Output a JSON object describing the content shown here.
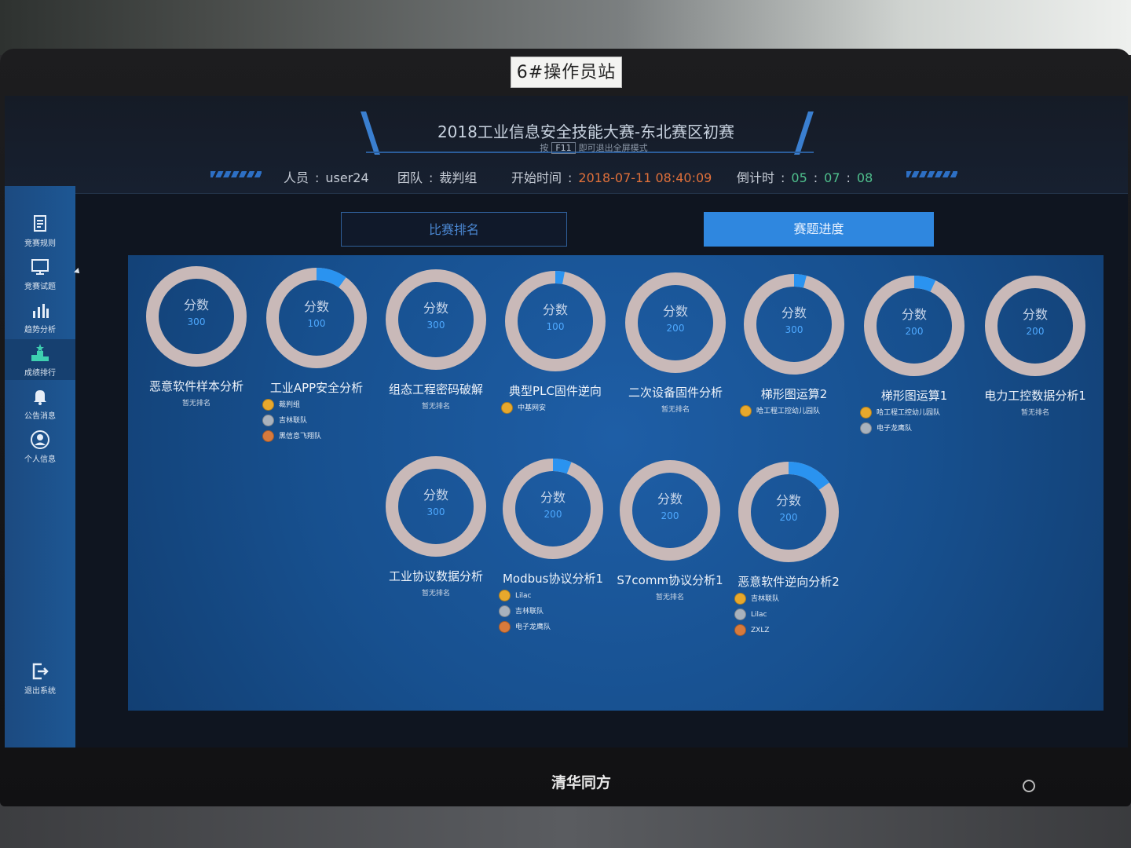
{
  "station_label": "6#操作员站",
  "monitor_brand": "清华同方",
  "header": {
    "title": "2018工业信息安全技能大赛-东北赛区初赛",
    "f11_prefix": "按",
    "f11_key": "F11",
    "f11_suffix": "即可退出全屏模式",
    "user_label": "人员",
    "user_value": "user24",
    "team_label": "团队",
    "team_value": "裁判组",
    "start_label": "开始时间",
    "start_value": "2018-07-11 08:40:09",
    "countdown_label": "倒计时",
    "countdown": [
      "05",
      "07",
      "08"
    ]
  },
  "sidebar": {
    "items": [
      {
        "label": "竞赛规则",
        "icon": "rules-icon"
      },
      {
        "label": "竞赛试题",
        "icon": "monitor-icon"
      },
      {
        "label": "趋势分析",
        "icon": "bar-chart-icon"
      },
      {
        "label": "成绩排行",
        "icon": "podium-icon"
      },
      {
        "label": "公告消息",
        "icon": "bell-icon"
      },
      {
        "label": "个人信息",
        "icon": "user-icon"
      }
    ],
    "logout": {
      "label": "退出系统",
      "icon": "logout-icon"
    }
  },
  "tabs": {
    "ranking": "比赛排名",
    "progress": "赛题进度"
  },
  "ring_caption": "分数",
  "no_rank_text": "暂无排名",
  "colors": {
    "ring_base": "#c9b9b8",
    "ring_progress": "#2a93f0",
    "accent": "#2f87df",
    "time": "#e0703a",
    "countdown": "#4fc08d"
  },
  "challenges": [
    {
      "name": "恶意软件样本分析",
      "score": "300",
      "progress": 0,
      "ranks": []
    },
    {
      "name": "工业APP安全分析",
      "score": "100",
      "progress": 0.1,
      "ranks": [
        {
          "medal": "gold",
          "team": "裁判组"
        },
        {
          "medal": "silver",
          "team": "吉林联队"
        },
        {
          "medal": "bronze",
          "team": "黑信息飞翔队"
        }
      ]
    },
    {
      "name": "组态工程密码破解",
      "score": "300",
      "progress": 0,
      "ranks": []
    },
    {
      "name": "典型PLC固件逆向",
      "score": "100",
      "progress": 0.03,
      "ranks": [
        {
          "medal": "gold",
          "team": "中基网安"
        }
      ]
    },
    {
      "name": "二次设备固件分析",
      "score": "200",
      "progress": 0,
      "ranks": []
    },
    {
      "name": "梯形图运算2",
      "score": "300",
      "progress": 0.04,
      "ranks": [
        {
          "medal": "gold",
          "team": "哈工程工控幼儿园队"
        }
      ]
    },
    {
      "name": "梯形图运算1",
      "score": "200",
      "progress": 0.07,
      "ranks": [
        {
          "medal": "gold",
          "team": "哈工程工控幼儿园队"
        },
        {
          "medal": "silver",
          "team": "电子龙鹰队"
        }
      ]
    },
    {
      "name": "电力工控数据分析1",
      "score": "200",
      "progress": 0,
      "ranks": []
    },
    {
      "name": "工业协议数据分析",
      "score": "300",
      "progress": 0,
      "ranks": []
    },
    {
      "name": "Modbus协议分析1",
      "score": "200",
      "progress": 0.06,
      "ranks": [
        {
          "medal": "gold",
          "team": "Lilac"
        },
        {
          "medal": "silver",
          "team": "吉林联队"
        },
        {
          "medal": "bronze",
          "team": "电子龙鹰队"
        }
      ]
    },
    {
      "name": "S7comm协议分析1",
      "score": "200",
      "progress": 0,
      "ranks": []
    },
    {
      "name": "恶意软件逆向分析2",
      "score": "200",
      "progress": 0.15,
      "ranks": [
        {
          "medal": "gold",
          "team": "吉林联队"
        },
        {
          "medal": "silver",
          "team": "Lilac"
        },
        {
          "medal": "bronze",
          "team": "ZXLZ"
        }
      ]
    }
  ]
}
